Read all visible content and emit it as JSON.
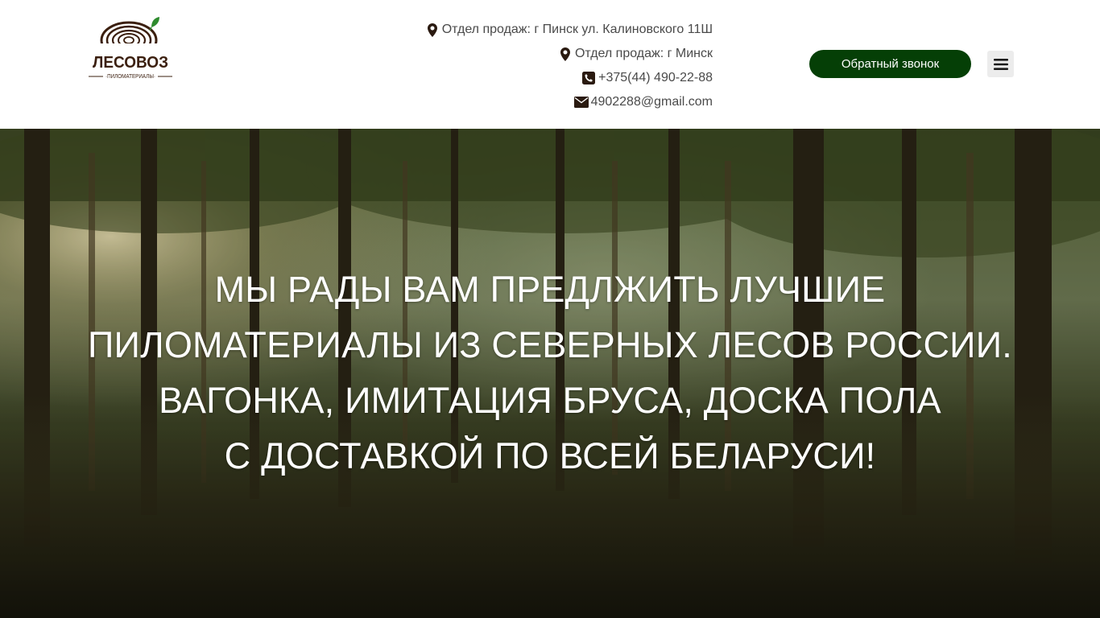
{
  "header": {
    "logo": {
      "name": "ЛЕСОВОЗ",
      "tagline": "·ПИЛОМАТЕРИАЛЫ·"
    },
    "contacts": [
      {
        "icon": "map-marker-icon",
        "text": "Отдел продаж: г Пинск ул. Калиновского 11Ш"
      },
      {
        "icon": "map-marker-icon",
        "text": "Отдел продаж: г Минск"
      },
      {
        "icon": "phone-icon",
        "text": "+375(44) 490-22-88"
      },
      {
        "icon": "envelope-icon",
        "text": "4902288@gmail.com"
      }
    ],
    "callback_button": "Обратный звонок",
    "menu_icon": "hamburger-menu-icon"
  },
  "hero": {
    "lines": [
      "МЫ РАДЫ ВАМ ПРЕДЛЖИТЬ ЛУЧШИЕ",
      "ПИЛОМАТЕРИАЛЫ ИЗ СЕВЕРНЫХ ЛЕСОВ РОССИИ.",
      "ВАГОНКА, ИМИТАЦИЯ БРУСА, ДОСКА ПОЛА",
      "С ДОСТАВКОЙ ПО ВСЕЙ БЕЛАРУСИ!"
    ]
  },
  "colors": {
    "brand_dark": "#3b1f0f",
    "button_green": "#053f06",
    "leaf_green": "#2e8b2e",
    "contact_text": "#4a4a4a"
  }
}
